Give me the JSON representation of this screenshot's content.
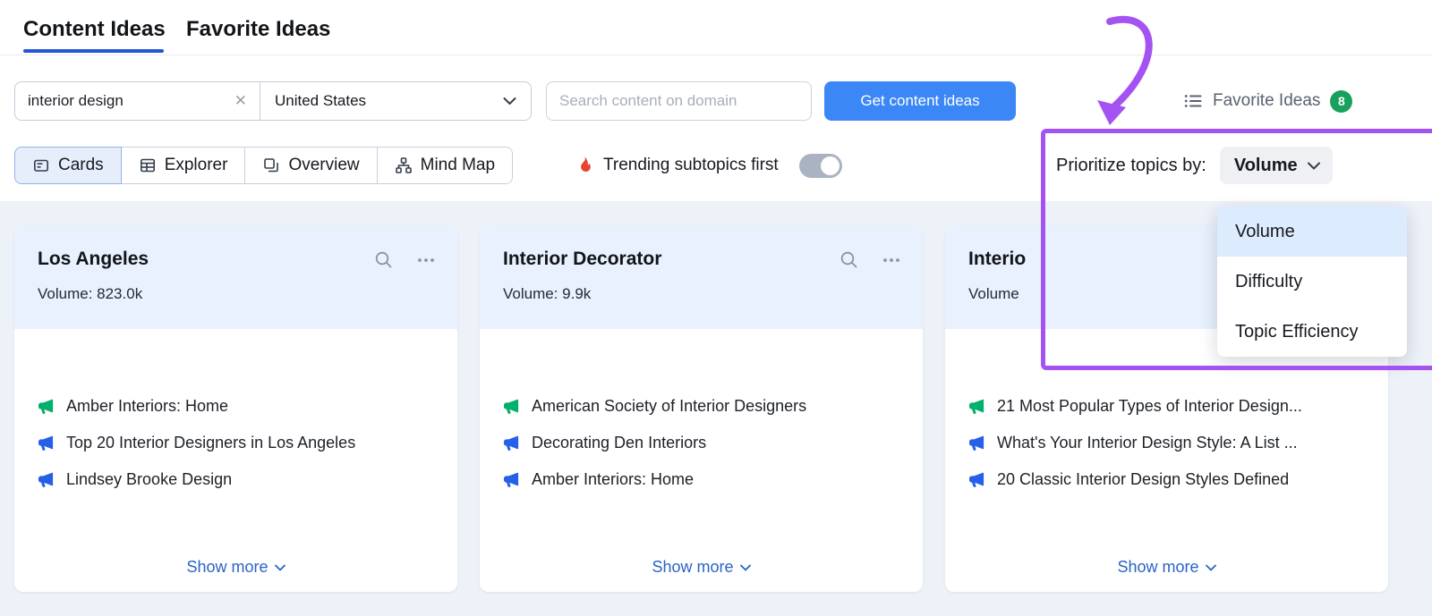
{
  "tabs": {
    "content_ideas": "Content Ideas",
    "favorite_ideas": "Favorite Ideas"
  },
  "toolbar": {
    "keyword_value": "interior design",
    "country_value": "United States",
    "domain_placeholder": "Search content on domain",
    "submit_label": "Get content ideas",
    "favorites_label": "Favorite Ideas",
    "favorites_count": "8"
  },
  "views": {
    "cards": "Cards",
    "explorer": "Explorer",
    "overview": "Overview",
    "mindmap": "Mind Map"
  },
  "trending": {
    "label": "Trending subtopics first",
    "on": false
  },
  "prioritize": {
    "label": "Prioritize topics by:",
    "selected": "Volume",
    "options": [
      "Volume",
      "Difficulty",
      "Topic Efficiency"
    ]
  },
  "cards": [
    {
      "title": "Los Angeles",
      "volume": "Volume: 823.0k",
      "show_more": "Show more",
      "items": [
        {
          "text": "Amber Interiors: Home"
        },
        {
          "text": "Top 20 Interior Designers in Los Angeles"
        },
        {
          "text": "Lindsey Brooke Design"
        }
      ]
    },
    {
      "title": "Interior Decorator",
      "volume": "Volume: 9.9k",
      "show_more": "Show more",
      "items": [
        {
          "text": "American Society of Interior Designers"
        },
        {
          "text": "Decorating Den Interiors"
        },
        {
          "text": "Amber Interiors: Home"
        }
      ]
    },
    {
      "title": "Interio",
      "volume": "Volume",
      "show_more": "Show more",
      "items": [
        {
          "text": "21 Most Popular Types of Interior Design..."
        },
        {
          "text": "What's Your Interior Design Style: A List ..."
        },
        {
          "text": "20 Classic Interior Design Styles Defined"
        }
      ]
    }
  ],
  "colors": {
    "accent_blue": "#3b87f5",
    "link_blue": "#2a63c7",
    "tab_underline_blue": "#2457d5",
    "badge_green": "#18a05c",
    "annotation_purple": "#a453f2",
    "menu_selected_bg": "#dcebfd",
    "card_header_bg": "#e8f1fd",
    "page_bg": "#edf1f8",
    "headline_icon_green": "#00b06b",
    "headline_icon_blue": "#2760e8",
    "fire_red": "#e8432d"
  }
}
